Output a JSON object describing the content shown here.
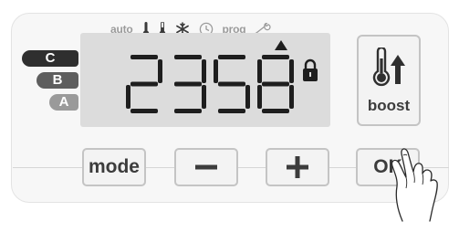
{
  "mode_bar": {
    "auto_label": "auto",
    "prog_label": "prog",
    "icons": [
      "thermometer-high-icon",
      "thermometer-low-icon",
      "snowflake-icon",
      "clock-icon",
      "wrench-icon"
    ]
  },
  "display": {
    "digits": [
      "2",
      "3",
      "5",
      "8"
    ],
    "lock_icon": "padlock-icon",
    "selector_marker": "triangle-up-icon"
  },
  "levels": [
    {
      "label": "C",
      "color": "#2f2f2f"
    },
    {
      "label": "B",
      "color": "#5e5e5e"
    },
    {
      "label": "A",
      "color": "#9a9a9a"
    }
  ],
  "boost": {
    "label": "boost",
    "icon": "thermometer-arrow-up-icon"
  },
  "buttons": {
    "mode_label": "mode",
    "minus_icon": "minus-icon",
    "plus_icon": "plus-icon",
    "ok_label": "OK"
  },
  "colors": {
    "panel": "#f7f7f7",
    "lcd_background": "#dcdcdc",
    "segment": "#1e1e1e",
    "button_border": "#c4c4c4",
    "icon_gray": "#9b9b9b"
  }
}
